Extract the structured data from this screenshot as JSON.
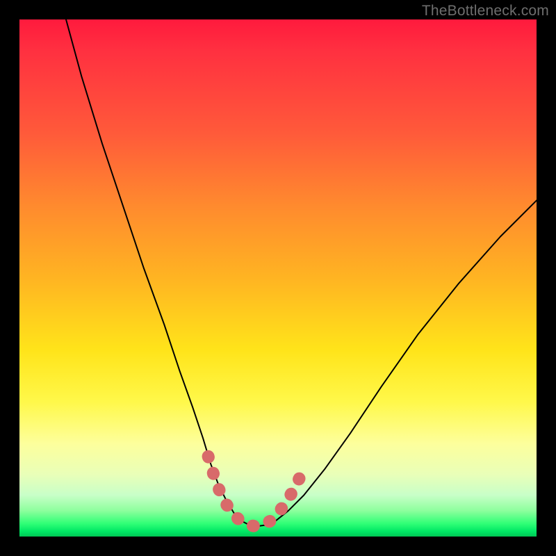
{
  "watermark": "TheBottleneck.com",
  "chart_data": {
    "type": "line",
    "title": "",
    "xlabel": "",
    "ylabel": "",
    "xlim": [
      0,
      100
    ],
    "ylim": [
      0,
      100
    ],
    "grid": false,
    "legend": false,
    "annotations": [],
    "series": [
      {
        "name": "bottleneck-curve",
        "color": "#000000",
        "x": [
          9,
          12,
          16,
          20,
          24,
          28,
          31,
          33.5,
          35.5,
          37,
          38.5,
          40,
          41.5,
          43,
          44.5,
          46,
          47.5,
          49.5,
          52,
          55,
          59,
          64,
          70,
          77,
          85,
          93,
          100
        ],
        "values": [
          100,
          89,
          76,
          64,
          52,
          41,
          32,
          25,
          19,
          14,
          10,
          7,
          4.5,
          3,
          2.2,
          2,
          2.2,
          3,
          5,
          8,
          13,
          20,
          29,
          39,
          49,
          58,
          65
        ]
      },
      {
        "name": "highlighted-minimum",
        "color": "#d86a6a",
        "x": [
          36.5,
          38,
          39.5,
          41,
          42.5,
          44,
          45.5,
          47,
          48.5,
          50,
          51.5,
          53,
          54.5
        ],
        "values": [
          15.5,
          10.5,
          7,
          4.8,
          3.2,
          2.3,
          2,
          2.2,
          3,
          4.5,
          6.5,
          9,
          12
        ]
      }
    ],
    "gradient_stops": [
      {
        "pos": 0,
        "color": "#ff1a3d"
      },
      {
        "pos": 0.06,
        "color": "#ff3040"
      },
      {
        "pos": 0.22,
        "color": "#ff5a3a"
      },
      {
        "pos": 0.36,
        "color": "#ff8a2e"
      },
      {
        "pos": 0.5,
        "color": "#ffb422"
      },
      {
        "pos": 0.64,
        "color": "#ffe41a"
      },
      {
        "pos": 0.74,
        "color": "#fff84a"
      },
      {
        "pos": 0.82,
        "color": "#fdff9c"
      },
      {
        "pos": 0.88,
        "color": "#e9ffb8"
      },
      {
        "pos": 0.92,
        "color": "#c8ffc8"
      },
      {
        "pos": 0.95,
        "color": "#8dff9d"
      },
      {
        "pos": 0.975,
        "color": "#30ff76"
      },
      {
        "pos": 0.99,
        "color": "#00e865"
      },
      {
        "pos": 1.0,
        "color": "#00c755"
      }
    ]
  }
}
